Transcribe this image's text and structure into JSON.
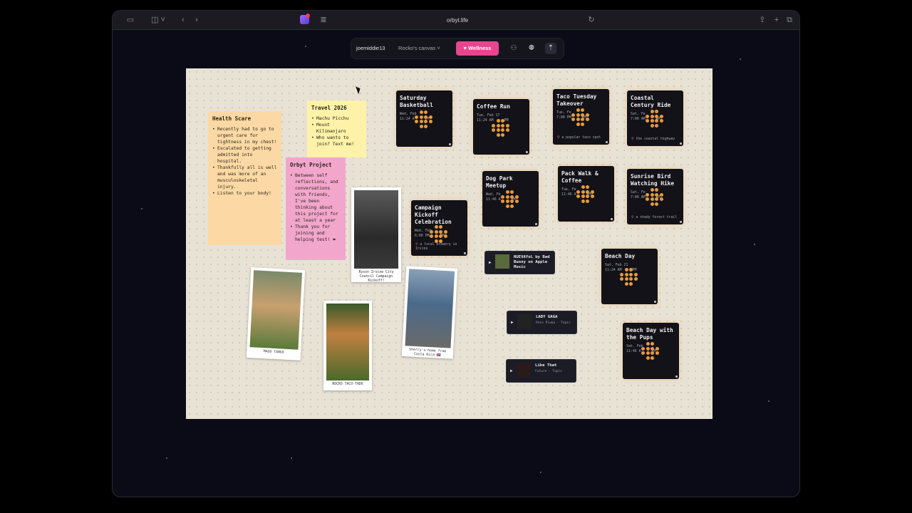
{
  "browser": {
    "url": "orbyt.life"
  },
  "toolbar": {
    "username": "joemiddie13",
    "canvas_select": "Rocko's canvas",
    "wellness_label": "Wellness"
  },
  "notes": {
    "health": {
      "title": "Health Scare",
      "items": [
        "Recently had to go to urgent care for tightness in my chest!",
        "Escalated to getting admitted into hospital.",
        "Thankfully all is well and was more of an musculoskeletal injury.",
        "Listen to your body!"
      ]
    },
    "travel": {
      "title": "Travel 2026",
      "items": [
        "Machu Picchu",
        "Mount Kilimanjaro",
        "Who wants to join? Text me!"
      ]
    },
    "orbyt": {
      "title": "Orbyt Project",
      "items": [
        "Between self reflections, and conversations with friends, I've been thinking about this project for at least a year",
        "Thank you for joining and helping test! ❤"
      ]
    }
  },
  "photos": {
    "council": "Ryson Irvine City Council Campaign Kickoff!",
    "mago": "MAGO TANGO",
    "rocko": "ROCKO TACO-TADO",
    "sherry": "Sherry's home from Costa Rica 🇨🇷"
  },
  "events": {
    "basketball": {
      "title": "Saturday Basketball",
      "date": "Wed, Feb",
      "time": "11:24 A",
      "time_end": "PM"
    },
    "coffee": {
      "title": "Coffee Run",
      "date": "Tue, Feb 17",
      "time": "11:24 AM",
      "time_end": "PM"
    },
    "taco": {
      "title": "Taco Tuesday Takeover",
      "date": "Tue, Fe",
      "time": "7:00 PM",
      "time_end": "PM",
      "location": "a popular taco spot"
    },
    "coastal": {
      "title": "Coastal Century Ride",
      "date": "Sat, Fe",
      "time": "7:00 AM",
      "time_end": "AM",
      "location": "the coastal highway"
    },
    "dogpark": {
      "title": "Dog Park Meetup",
      "date": "Wed, Fe",
      "time": "11:46 A",
      "time_end": "PM"
    },
    "packwalk": {
      "title": "Pack Walk & Coffee",
      "date": "Tue, Fe",
      "time": "11:46 A",
      "time_end": "PM"
    },
    "sunrise": {
      "title": "Sunrise Bird Watching Hike",
      "date": "Sat, Fe",
      "time": "7:00 AM",
      "time_end": "AM",
      "location": "a shady forest trail"
    },
    "campaign": {
      "title": "Campaign Kickoff Celebration",
      "date": "Wed, Feb",
      "time": "6:00 PM",
      "time_end": "PM",
      "location": "a local brewery in Irvine"
    },
    "beach": {
      "title": "Beach Day",
      "date": "Sat, Feb 21",
      "time": "11:24 AM",
      "time_end": "PM"
    },
    "beachpups": {
      "title": "Beach Day with the Pups",
      "date": "Sat, Feb",
      "time": "11:46 A",
      "time_end": "PM"
    }
  },
  "music": {
    "nuevayol": {
      "title": "NUEVAYoL by Bad Bunny on Apple Music"
    },
    "ladygaga": {
      "title": "LADY GAGA",
      "sub": "Peso Pluma - Topic"
    },
    "likethat": {
      "title": "Like That",
      "sub": "Future - Topic"
    }
  }
}
